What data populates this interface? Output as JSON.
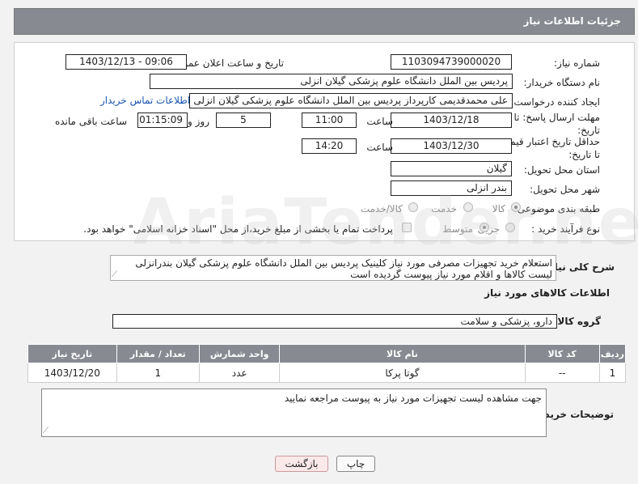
{
  "header": {
    "title": "جزئیات اطلاعات نیاز"
  },
  "form": {
    "need_number_label": "شماره نیاز:",
    "need_number": "1103094739000020",
    "announce_label": "تاریخ و ساعت اعلان عمومی:",
    "announce_value": "1403/12/13 - 09:06",
    "buyer_org_label": "نام دستگاه خریدار:",
    "buyer_org": "پردیس بین الملل دانشگاه علوم پزشکی گیلان انزلی",
    "creator_label": "ایجاد کننده درخواست:",
    "creator": "علی  محمدقدیمی کارپرداز پردیس بین الملل دانشگاه علوم پزشکی گیلان انزلی",
    "contact_link": "اطلاعات تماس خریدار",
    "reply_deadline_label": "مهلت ارسال پاسخ: تا تاریخ:",
    "reply_date": "1403/12/18",
    "time_label": "ساعت",
    "reply_time": "11:00",
    "days": "5",
    "days_label": "روز و",
    "remaining_time": "01:15:09",
    "remaining_label": "ساعت باقی مانده",
    "price_deadline_label": "حداقل تاریخ اعتبار قیمت: تا تاریخ:",
    "price_date": "1403/12/30",
    "price_time_label": "ساعت",
    "price_time": "14:20",
    "province_label": "استان محل تحویل:",
    "province": "گیلان",
    "city_label": "شهر محل تحویل:",
    "city": "بندر انزلی",
    "category_label": "طبقه بندی موضوعی:",
    "category_options": [
      "کالا",
      "خدمت",
      "کالا/خدمت"
    ],
    "process_label": "نوع فرآیند خرید :",
    "process_options": [
      "جزیی",
      "متوسط"
    ],
    "payment_note": "پرداخت تمام یا بخشی از مبلغ خرید،از محل \"اسناد خزانه اسلامی\" خواهد بود."
  },
  "description": {
    "label": "شرح کلی نیاز:",
    "line1": "استعلام خرید تجهیزات مصرفی مورد نیاز کلینیک پردیس بین الملل دانشگاه علوم پزشکی گیلان بندرانزلی",
    "line2": "لیست کالاها و اقلام مورد نیاز پیوست گردیده است"
  },
  "goods": {
    "section_title": "اطلاعات کالاهای مورد نیاز",
    "group_label": "گروه کالا:",
    "group_value": "دارو، پزشکی و سلامت",
    "columns": [
      "ردیف",
      "کد کالا",
      "نام کالا",
      "واحد شمارش",
      "تعداد / مقدار",
      "تاریخ نیاز"
    ],
    "rows": [
      [
        "1",
        "--",
        "گوتا پرکا",
        "عدد",
        "1",
        "1403/12/20"
      ]
    ]
  },
  "buyer_notes": {
    "label": "توضیحات خریدار:",
    "text": "جهت مشاهده لیست تجهیزات مورد نیاز به پیوست مراجعه نمایید"
  },
  "buttons": {
    "print": "چاپ",
    "back": "بازگشت"
  },
  "watermark": "AriaTender.neT"
}
